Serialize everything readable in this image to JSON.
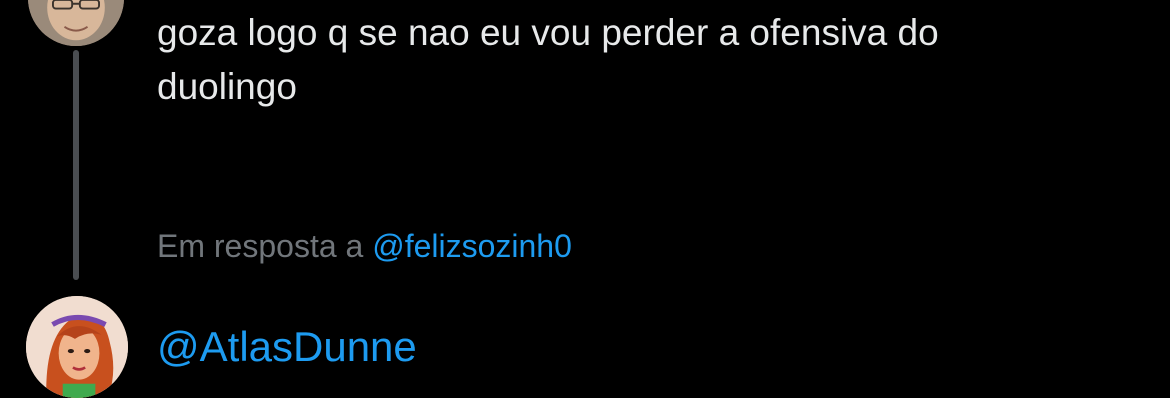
{
  "tweet": {
    "text": "goza logo q se nao eu vou perder a ofensiva do\nduolingo"
  },
  "reply_context": {
    "prefix": "Em resposta a",
    "handle": "@felizsozinh0"
  },
  "next_tweet": {
    "handle": "@AtlasDunne"
  },
  "colors": {
    "background": "#000000",
    "text": "#e7e9ea",
    "muted": "#71767b",
    "link": "#1d9bf0",
    "thread_line": "#4a4d51"
  }
}
